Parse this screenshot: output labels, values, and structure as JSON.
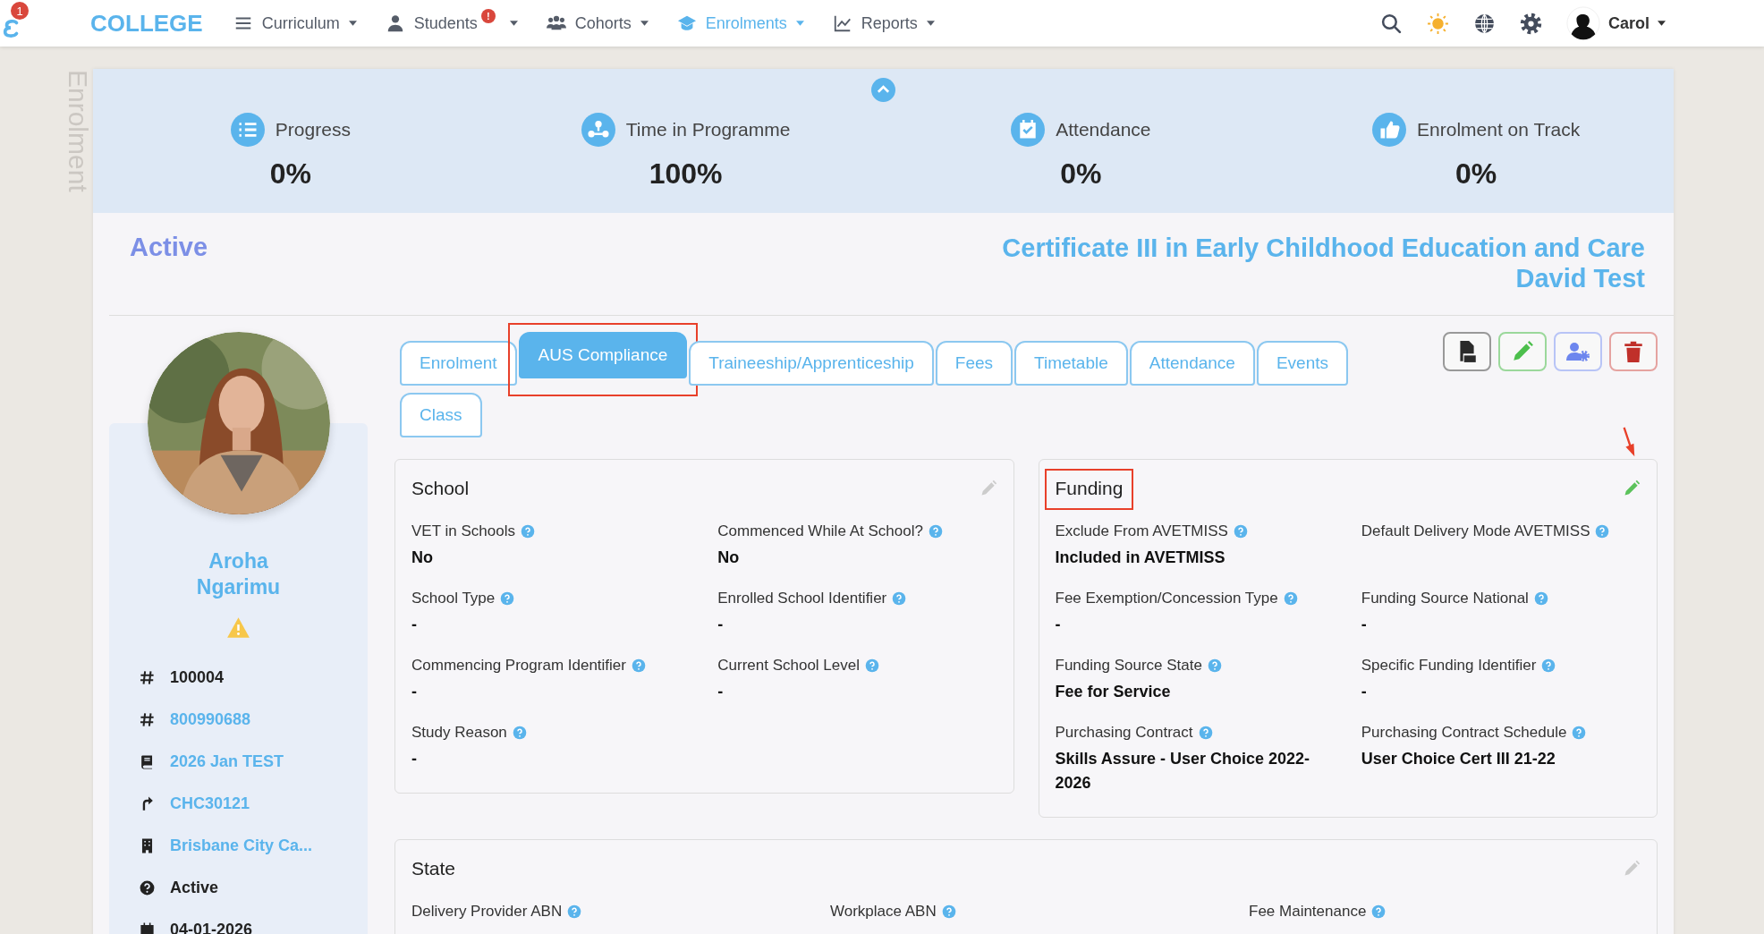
{
  "nav": {
    "logo_badge": "1",
    "brand": "COLLEGE",
    "menu": [
      {
        "label": "Curriculum",
        "kind": "menu",
        "selected": false
      },
      {
        "label": "Students",
        "kind": "user",
        "selected": false,
        "badge": "!"
      },
      {
        "label": "Cohorts",
        "kind": "users",
        "selected": false
      },
      {
        "label": "Enrolments",
        "kind": "cap",
        "selected": true
      },
      {
        "label": "Reports",
        "kind": "chart",
        "selected": false
      }
    ],
    "user": "Carol"
  },
  "side_label": "Enrolment",
  "stats": [
    {
      "label": "Progress",
      "value": "0%",
      "kind": "list"
    },
    {
      "label": "Time in Programme",
      "value": "100%",
      "kind": "network"
    },
    {
      "label": "Attendance",
      "value": "0%",
      "kind": "calendar"
    },
    {
      "label": "Enrolment on Track",
      "value": "0%",
      "kind": "thumb"
    }
  ],
  "status": "Active",
  "heading": [
    "Certificate III in Early Childhood Education and Care",
    "David Test"
  ],
  "tabs": [
    {
      "label": "Enrolment",
      "selected": false,
      "highlighted": false
    },
    {
      "label": "AUS Compliance",
      "selected": true,
      "highlighted": true
    },
    {
      "label": "Traineeship/Apprenticeship",
      "selected": false,
      "highlighted": false
    },
    {
      "label": "Fees",
      "selected": false,
      "highlighted": false
    },
    {
      "label": "Timetable",
      "selected": false,
      "highlighted": false
    },
    {
      "label": "Attendance",
      "selected": false,
      "highlighted": false
    },
    {
      "label": "Events",
      "selected": false,
      "highlighted": false
    },
    {
      "label": "Class",
      "selected": false,
      "highlighted": false
    }
  ],
  "actions": [
    {
      "kind": "pdf"
    },
    {
      "kind": "edit"
    },
    {
      "kind": "user-settings"
    },
    {
      "kind": "delete"
    }
  ],
  "profile": {
    "name": "Aroha Ngarimu",
    "details": [
      {
        "kind": "hash",
        "text": "100004",
        "link": false
      },
      {
        "kind": "hash",
        "text": "800990688",
        "link": true
      },
      {
        "kind": "book",
        "text": "2026 Jan TEST",
        "link": true
      },
      {
        "kind": "turn",
        "text": "CHC30121",
        "link": true
      },
      {
        "kind": "building",
        "text": "Brisbane City Ca...",
        "link": true
      },
      {
        "kind": "question",
        "text": "Active",
        "link": false
      },
      {
        "kind": "calendar",
        "text": "04-01-2026",
        "link": false
      }
    ]
  },
  "panels": [
    {
      "title": "School",
      "highlighted": false,
      "edit_enabled": false,
      "fields": [
        {
          "label": "VET in Schools",
          "value": "No"
        },
        {
          "label": "Commenced While At School?",
          "value": "No"
        },
        {
          "label": "School Type",
          "value": "-"
        },
        {
          "label": "Enrolled School Identifier",
          "value": "-"
        },
        {
          "label": "Commencing Program Identifier",
          "value": "-"
        },
        {
          "label": "Current School Level",
          "value": "-"
        },
        {
          "label": "Study Reason",
          "value": "-"
        }
      ]
    },
    {
      "title": "Funding",
      "highlighted": true,
      "edit_enabled": true,
      "fields": [
        {
          "label": "Exclude From AVETMISS",
          "value": "Included in AVETMISS"
        },
        {
          "label": "Default Delivery Mode AVETMISS"
        },
        {
          "label": "Fee Exemption/Concession Type",
          "value": "-"
        },
        {
          "label": "Funding Source National",
          "value": "-"
        },
        {
          "label": "Funding Source State",
          "value": "Fee for Service"
        },
        {
          "label": "Specific Funding Identifier",
          "value": "-"
        },
        {
          "label": "Purchasing Contract",
          "value": "Skills Assure - User Choice 2022-2026"
        },
        {
          "label": "Purchasing Contract Schedule",
          "value": "User Choice Cert III 21-22"
        }
      ]
    }
  ],
  "state_panel": {
    "title": "State",
    "edit_enabled": false,
    "fields": [
      {
        "label": "Delivery Provider ABN"
      },
      {
        "label": "Workplace ABN"
      },
      {
        "label": "Fee Maintenance"
      }
    ]
  }
}
